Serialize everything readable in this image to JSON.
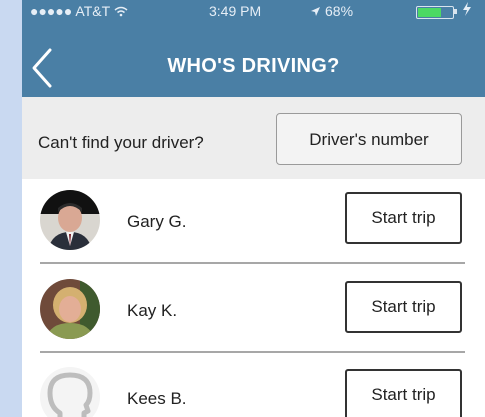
{
  "status_bar": {
    "carrier": "●●●●● AT&T ",
    "wifi_icon": "wifi-icon",
    "time": "3:49 PM",
    "location_icon": "location-arrow-icon",
    "battery_percent": "68%",
    "battery_level": 0.68,
    "charging_icon": "charging-bolt-icon"
  },
  "header": {
    "title": "WHO'S DRIVING?",
    "back_icon": "chevron-left-icon",
    "background_color": "#4a7fa5"
  },
  "find_driver": {
    "prompt": "Can't find your driver?",
    "button_label": "Driver's number"
  },
  "drivers": [
    {
      "name": "Gary G.",
      "button_label": "Start trip"
    },
    {
      "name": "Kay K.",
      "button_label": "Start trip"
    },
    {
      "name": "Kees B.",
      "button_label": "Start trip"
    }
  ]
}
